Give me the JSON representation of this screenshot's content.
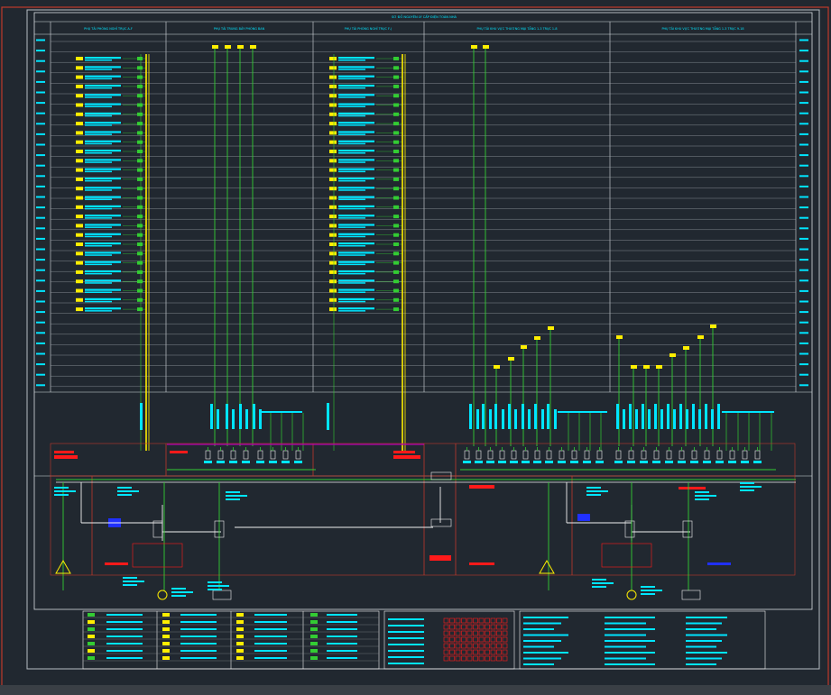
{
  "drawing": {
    "title": "SƠ ĐỒ NGUYÊN LÝ CẤP ĐIỆN TOÀN NHÀ",
    "sections": [
      "PHỤ TẢI PHÒNG NGHỈ TRỤC A-F",
      "PHỤ TẢI TRUNG BẢY PHÒNG BAN",
      "PHỤ TẢI PHÒNG NGHỈ TRỤC F-J",
      "PHỤ TẢI KHU VỰC THƯƠNG MẠI TẦNG 1-3 TRỤC 1-8",
      "PHỤ TẢI KHU VỰC THƯƠNG MẠI TẦNG 1-3 TRỤC 9-18"
    ]
  },
  "colors": {
    "background": "#212830",
    "frame": "#c0392b",
    "grid": "#d8dde2",
    "cyan": "#00e5ff",
    "green": "#33cc33",
    "yellow": "#ffee00",
    "red": "#ff1a1a",
    "magenta": "#b000b0",
    "blue": "#2030ff",
    "white": "#f0f0f0"
  }
}
